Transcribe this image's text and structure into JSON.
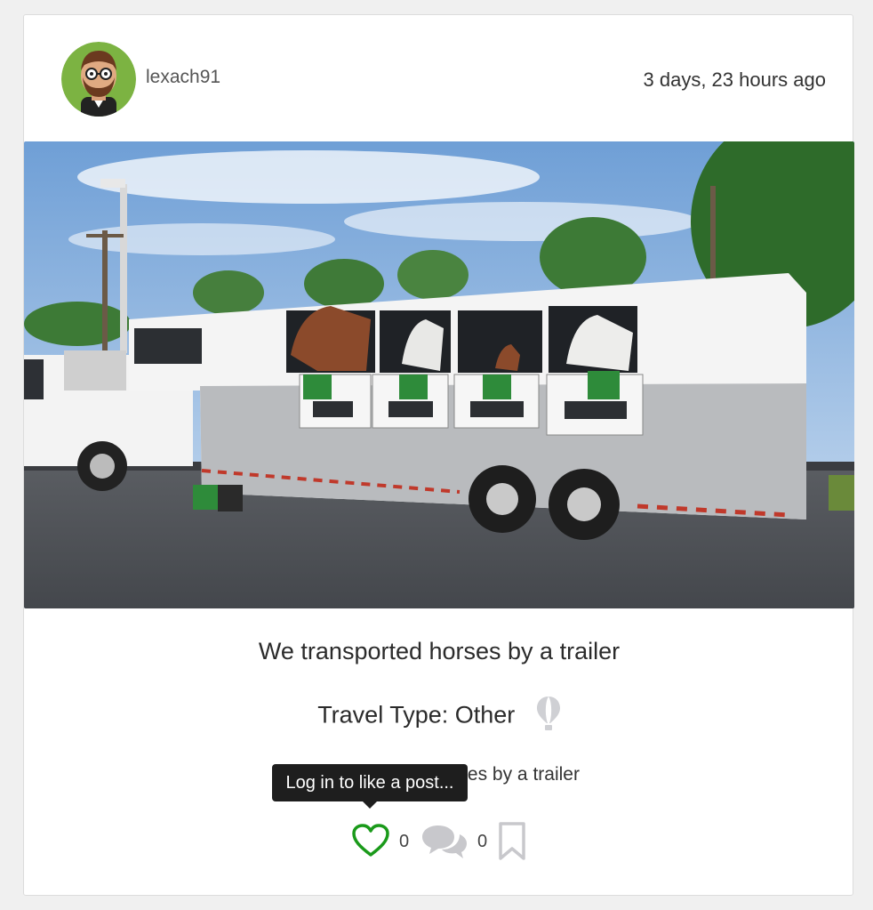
{
  "post": {
    "username": "lexach91",
    "timestamp": "3 days, 23 hours ago",
    "title": "We transported horses by a trailer",
    "travel_type": "Travel Type: Other",
    "description": "We transported horses by a trailer",
    "like_count": "0",
    "comment_count": "0"
  },
  "tooltip": {
    "text": "Log in to like a post..."
  },
  "icons": {
    "like": "heart-icon",
    "comments": "comments-icon",
    "bookmark": "bookmark-icon",
    "travel_type": "balloon-icon"
  },
  "colors": {
    "like_accent": "#1a9a1a",
    "muted_icon": "#c8c8cc"
  }
}
